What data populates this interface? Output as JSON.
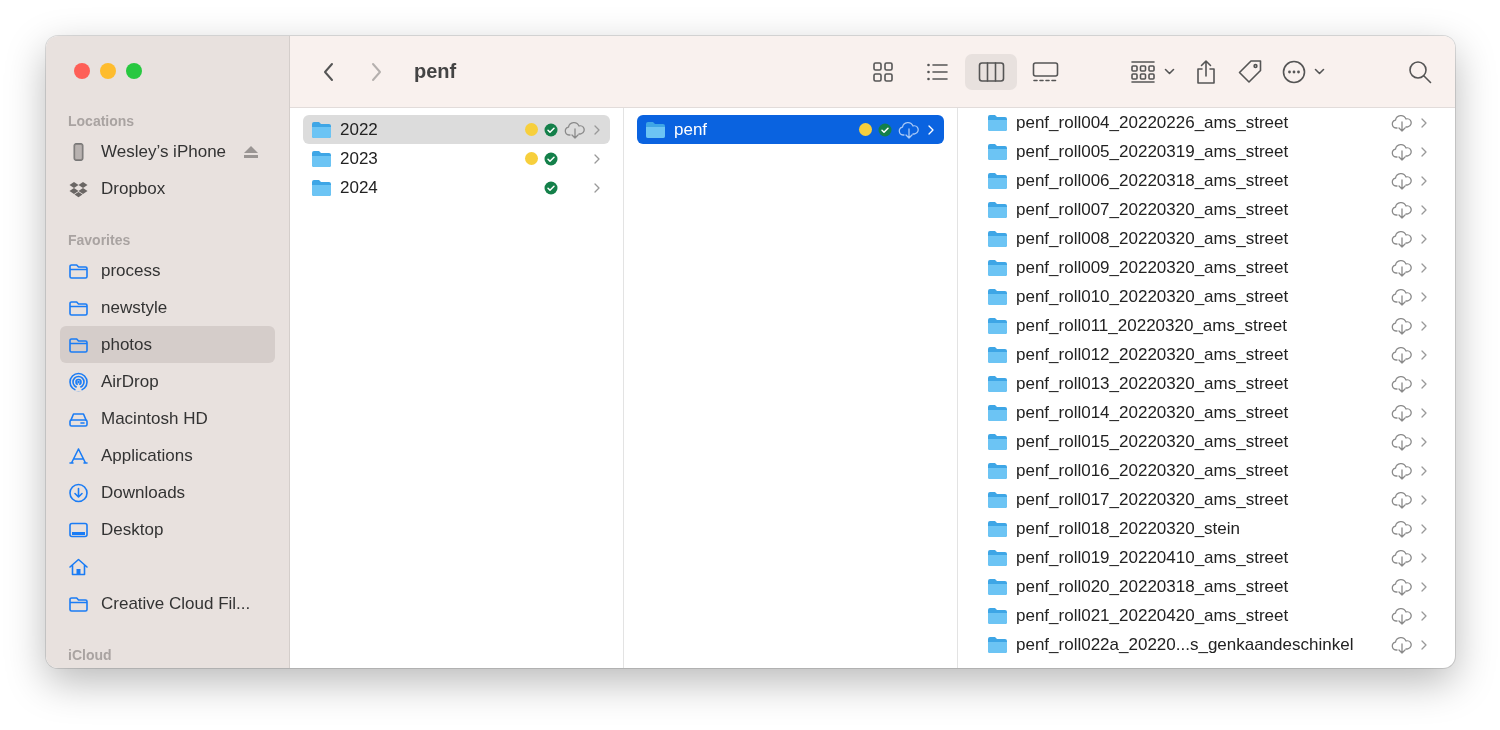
{
  "window": {
    "title": "penf"
  },
  "toolbar": {
    "back": {
      "disabled": false
    },
    "forward": {
      "disabled": true
    },
    "views": [
      {
        "kind": "icons",
        "selected": false
      },
      {
        "kind": "list",
        "selected": false
      },
      {
        "kind": "columns",
        "selected": true
      },
      {
        "kind": "gallery",
        "selected": false
      }
    ],
    "actions": [
      {
        "kind": "group"
      },
      {
        "kind": "share"
      },
      {
        "kind": "tag"
      },
      {
        "kind": "more"
      },
      {
        "kind": "search"
      }
    ]
  },
  "sidebar": {
    "sections": [
      {
        "header": "Locations",
        "items": [
          {
            "kind": "phone",
            "label": "Wesley’s iPhone",
            "selected": false,
            "eject": true
          },
          {
            "kind": "dropbox",
            "label": "Dropbox",
            "selected": false,
            "eject": false
          }
        ]
      },
      {
        "header": "Favorites",
        "items": [
          {
            "kind": "folder",
            "label": "process",
            "selected": false,
            "eject": false
          },
          {
            "kind": "folder",
            "label": "newstyle",
            "selected": false,
            "eject": false
          },
          {
            "kind": "folder",
            "label": "photos",
            "selected": true,
            "eject": false
          },
          {
            "kind": "airdrop",
            "label": "AirDrop",
            "selected": false,
            "eject": false
          },
          {
            "kind": "drive",
            "label": "Macintosh HD",
            "selected": false,
            "eject": false
          },
          {
            "kind": "apps",
            "label": "Applications",
            "selected": false,
            "eject": false
          },
          {
            "kind": "downloads",
            "label": "Downloads",
            "selected": false,
            "eject": false
          },
          {
            "kind": "desktop",
            "label": "Desktop",
            "selected": false,
            "eject": false
          },
          {
            "kind": "home",
            "selected": false,
            "eject": false
          },
          {
            "kind": "folder",
            "label": "Creative Cloud Fil...",
            "selected": false,
            "eject": false
          }
        ]
      },
      {
        "header": "iCloud"
      }
    ]
  },
  "columns": [
    {
      "items": [
        {
          "name": "2022",
          "selected": true,
          "color": "#f7cf3c",
          "synced": true,
          "cloud": true
        },
        {
          "name": "2023",
          "selected": false,
          "color": "#f7cf3c",
          "synced": true,
          "cloud": false
        },
        {
          "name": "2024",
          "selected": false,
          "synced": true,
          "cloud": false
        }
      ]
    },
    {
      "items": [
        {
          "name": "penf",
          "selected": true,
          "color": "#f7cf3c",
          "synced": true,
          "cloud": true
        }
      ]
    },
    {
      "items": [
        {
          "name": "penf_roll004_20220226_ams_street",
          "selected": false,
          "synced": false,
          "cloud": true
        },
        {
          "name": "penf_roll005_20220319_ams_street",
          "selected": false,
          "synced": false,
          "cloud": true
        },
        {
          "name": "penf_roll006_20220318_ams_street",
          "selected": false,
          "synced": false,
          "cloud": true
        },
        {
          "name": "penf_roll007_20220320_ams_street",
          "selected": false,
          "synced": false,
          "cloud": true
        },
        {
          "name": "penf_roll008_20220320_ams_street",
          "selected": false,
          "synced": false,
          "cloud": true
        },
        {
          "name": "penf_roll009_20220320_ams_street",
          "selected": false,
          "synced": false,
          "cloud": true
        },
        {
          "name": "penf_roll010_20220320_ams_street",
          "selected": false,
          "synced": false,
          "cloud": true
        },
        {
          "name": "penf_roll011_20220320_ams_street",
          "selected": false,
          "synced": false,
          "cloud": true
        },
        {
          "name": "penf_roll012_20220320_ams_street",
          "selected": false,
          "synced": false,
          "cloud": true
        },
        {
          "name": "penf_roll013_20220320_ams_street",
          "selected": false,
          "synced": false,
          "cloud": true
        },
        {
          "name": "penf_roll014_20220320_ams_street",
          "selected": false,
          "synced": false,
          "cloud": true
        },
        {
          "name": "penf_roll015_20220320_ams_street",
          "selected": false,
          "synced": false,
          "cloud": true
        },
        {
          "name": "penf_roll016_20220320_ams_street",
          "selected": false,
          "synced": false,
          "cloud": true
        },
        {
          "name": "penf_roll017_20220320_ams_street",
          "selected": false,
          "synced": false,
          "cloud": true
        },
        {
          "name": "penf_roll018_20220320_stein",
          "selected": false,
          "synced": false,
          "cloud": true
        },
        {
          "name": "penf_roll019_20220410_ams_street",
          "selected": false,
          "synced": false,
          "cloud": true
        },
        {
          "name": "penf_roll020_20220318_ams_street",
          "selected": false,
          "synced": false,
          "cloud": true
        },
        {
          "name": "penf_roll021_20220420_ams_street",
          "selected": false,
          "synced": false,
          "cloud": true
        },
        {
          "name": "penf_roll022a_20220...s_genkaandeschinkel",
          "selected": false,
          "synced": false,
          "cloud": true
        }
      ]
    }
  ]
}
